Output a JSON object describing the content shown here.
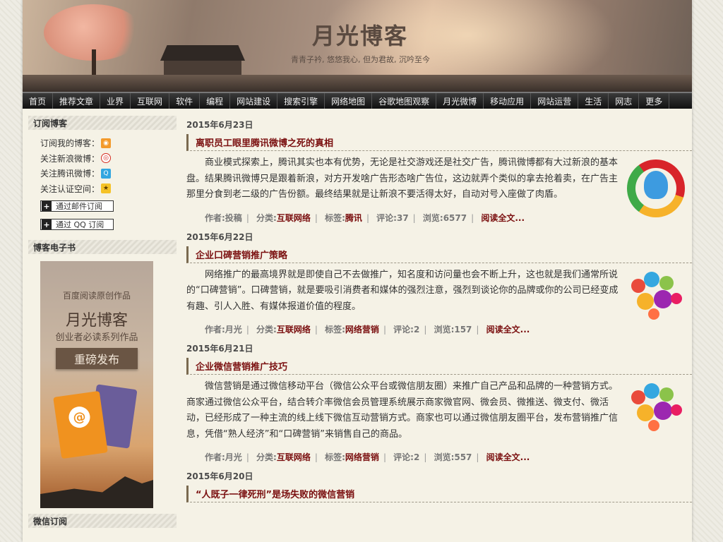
{
  "site": {
    "title": "月光博客",
    "subtitle": "青青子衿, 悠悠我心, 但为君故, 沉吟至今"
  },
  "nav": [
    "首页",
    "推荐文章",
    "业界",
    "互联网",
    "软件",
    "编程",
    "网站建设",
    "搜索引擎",
    "网络地图",
    "谷歌地图观察",
    "月光微博",
    "移动应用",
    "网站运营",
    "生活",
    "网志",
    "更多"
  ],
  "sidebar": {
    "subscribe": {
      "heading": "订阅博客",
      "items": [
        {
          "label": "订阅我的博客：",
          "icon": "rss-icon"
        },
        {
          "label": "关注新浪微博：",
          "icon": "weibo-icon"
        },
        {
          "label": "关注腾讯微博：",
          "icon": "tencent-weibo-icon"
        },
        {
          "label": "关注认证空间：",
          "icon": "certified-space-icon"
        }
      ],
      "email_button": "通过邮件订阅",
      "qq_button": "通过 QQ 订阅"
    },
    "ebook": {
      "heading": "博客电子书",
      "line1": "百度阅读原创作品",
      "line2": "月光博客",
      "line3": "创业者必读系列作品",
      "badge": "重磅发布"
    },
    "wechat": {
      "heading": "微信订阅"
    }
  },
  "posts": [
    {
      "date": "2015年6月23日",
      "title": "离职员工眼里腾讯微博之死的真相",
      "body": "商业模式探索上，腾讯其实也本有优势，无论是社交游戏还是社交广告，腾讯微博都有大过新浪的基本盘。结果腾讯微博只是跟着新浪，对方开发啥广告形态啥广告位，这边就弄个类似的拿去抢着卖，在广告主那里分食到老二级的广告份额。最终结果就是让新浪不要活得太好，自动对号入座做了肉盾。",
      "author": "作者:投稿",
      "category_label": "分类:",
      "category": "互联网络",
      "tag_label": "标签:",
      "tag": "腾讯",
      "comments": "评论:37",
      "views": "浏览:6577",
      "read_more": "阅读全文...",
      "thumb": "tencent-qq-logo"
    },
    {
      "date": "2015年6月22日",
      "title": "企业口碑营销推广策略",
      "body": "网络推广的最高境界就是即使自己不去做推广，知名度和访问量也会不断上升，这也就是我们通常所说的“口碑营销”。口碑营销，就是要吸引消费者和媒体的强烈注意，强烈到谈论你的品牌或你的公司已经变成有趣、引人入胜、有媒体报道价值的程度。",
      "author": "作者:月光",
      "category_label": "分类:",
      "category": "互联网络",
      "tag_label": "标签:",
      "tag": "网络营销",
      "comments": "评论:2",
      "views": "浏览:157",
      "read_more": "阅读全文...",
      "thumb": "social-bubbles-icon"
    },
    {
      "date": "2015年6月21日",
      "title": "企业微信营销推广技巧",
      "body": "微信营销是通过微信移动平台（微信公众平台或微信朋友圈）来推广自己产品和品牌的一种营销方式。商家通过微信公众平台，结合转介率微信会员管理系统展示商家微官网、微会员、微推送、微支付、微活动，已经形成了一种主流的线上线下微信互动营销方式。商家也可以通过微信朋友圈平台，发布营销推广信息，凭借“熟人经济”和“口碑营销”来销售自己的商品。",
      "author": "作者:月光",
      "category_label": "分类:",
      "category": "互联网络",
      "tag_label": "标签:",
      "tag": "网络营销",
      "comments": "评论:2",
      "views": "浏览:557",
      "read_more": "阅读全文...",
      "thumb": "social-bubbles-icon"
    },
    {
      "date": "2015年6月20日",
      "title": "“人既子一律死刑”是场失败的微信营销"
    }
  ]
}
